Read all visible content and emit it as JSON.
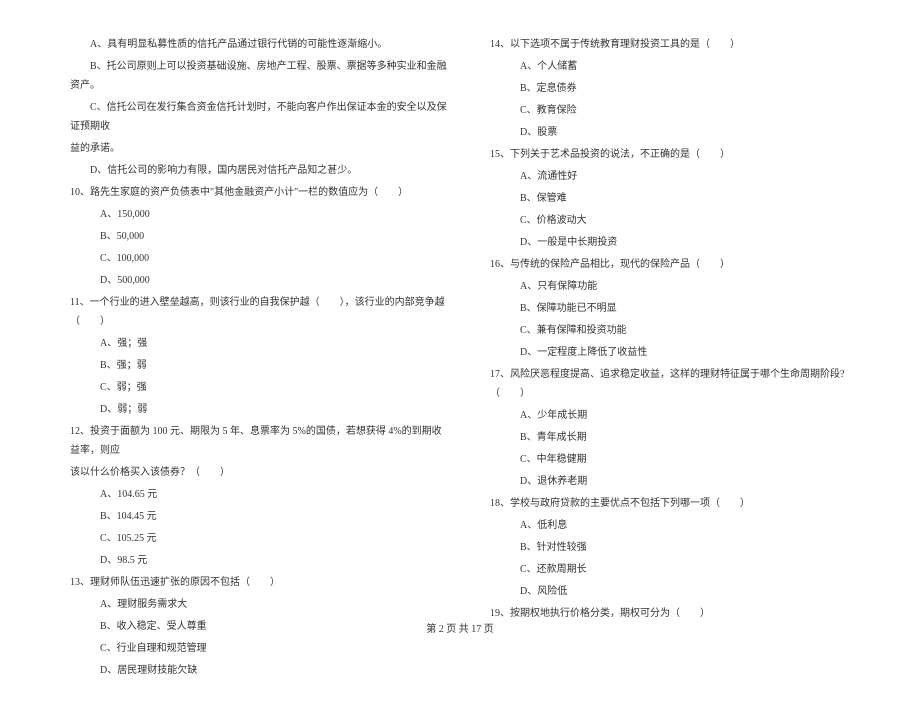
{
  "leftColumn": {
    "statements": [
      "A、具有明显私募性质的信托产品通过银行代销的可能性逐渐缩小。",
      "B、托公司原则上可以投资基础设施、房地产工程、股票、票据等多种实业和金融资产。",
      "C、信托公司在发行集合资金信托计划时，不能向客户作出保证本金的安全以及保证预期收",
      "益的承诺。",
      "D、信托公司的影响力有限，国内居民对信托产品知之甚少。"
    ],
    "questions": [
      {
        "number": "10",
        "text": "、路先生家庭的资产负债表中\"其他金融资产小计\"一栏的数值应为（　　）",
        "options": [
          "A、150,000",
          "B、50,000",
          "C、100,000",
          "D、500,000"
        ]
      },
      {
        "number": "11",
        "text": "、一个行业的进入壁垒越高，则该行业的自我保护越（　　），该行业的内部竞争越（　　）",
        "options": [
          "A、强；强",
          "B、强；弱",
          "C、弱；强",
          "D、弱；弱"
        ]
      },
      {
        "number": "12",
        "text": "、投资于面额为 100 元、期限为 5 年、息票率为 5%的国债，若想获得 4%的到期收益率，则应",
        "textContinue": "该以什么价格买入该债券？（　　）",
        "options": [
          "A、104.65 元",
          "B、104.45 元",
          "C、105.25 元",
          "D、98.5 元"
        ]
      },
      {
        "number": "13",
        "text": "、理财师队伍迅速扩张的原因不包括（　　）",
        "options": [
          "A、理财服务需求大",
          "B、收入稳定、受人尊重",
          "C、行业自理和规范管理",
          "D、居民理财技能欠缺"
        ]
      }
    ]
  },
  "rightColumn": {
    "questions": [
      {
        "number": "14",
        "text": "、以下选项不属于传统教育理财投资工具的是（　　）",
        "options": [
          "A、个人储蓄",
          "B、定息债券",
          "C、教育保险",
          "D、股票"
        ]
      },
      {
        "number": "15",
        "text": "、下列关于艺术品投资的说法，不正确的是（　　）",
        "options": [
          "A、流通性好",
          "B、保管难",
          "C、价格波动大",
          "D、一般是中长期投资"
        ]
      },
      {
        "number": "16",
        "text": "、与传统的保险产品相比，现代的保险产品（　　）",
        "options": [
          "A、只有保障功能",
          "B、保障功能已不明显",
          "C、兼有保障和投资功能",
          "D、一定程度上降低了收益性"
        ]
      },
      {
        "number": "17",
        "text": "、风险厌恶程度提高、追求稳定收益，这样的理财特征属于哪个生命周期阶段?（　　）",
        "options": [
          "A、少年成长期",
          "B、青年成长期",
          "C、中年稳健期",
          "D、退休养老期"
        ]
      },
      {
        "number": "18",
        "text": "、学校与政府贷款的主要优点不包括下列哪一项（　　）",
        "options": [
          "A、低利息",
          "B、针对性较强",
          "C、还款周期长",
          "D、风险低"
        ]
      },
      {
        "number": "19",
        "text": "、按期权地执行价格分类，期权可分为（　　）",
        "options": []
      }
    ]
  },
  "footer": "第 2 页 共 17 页"
}
